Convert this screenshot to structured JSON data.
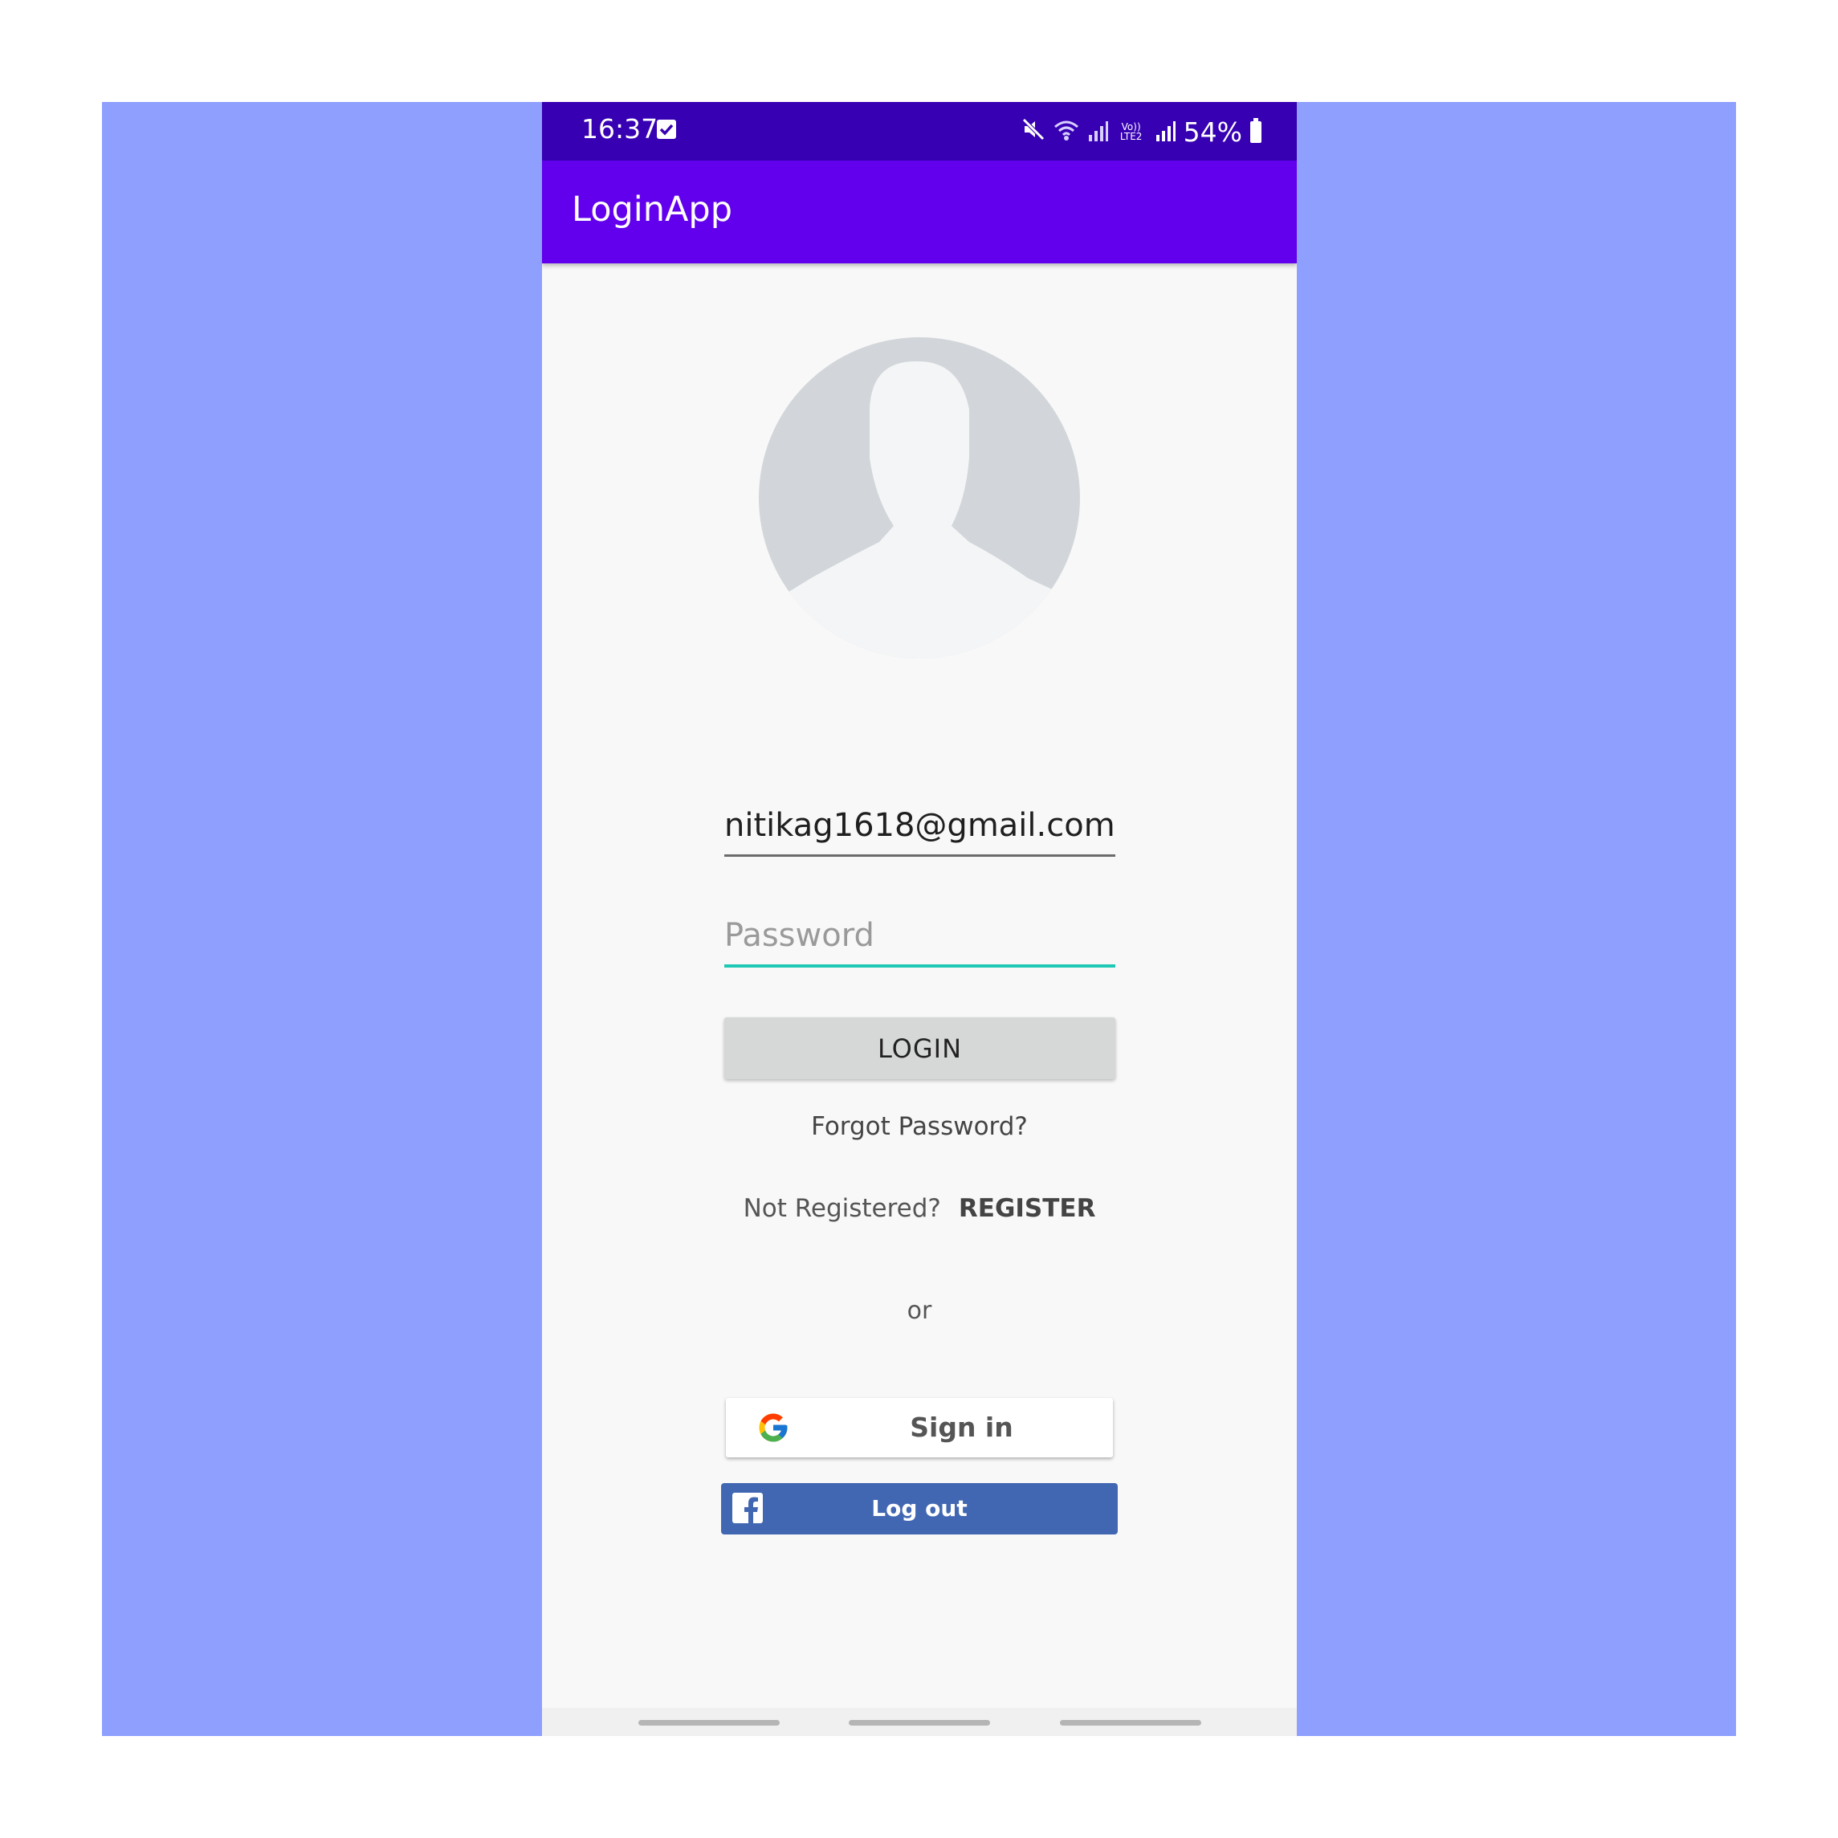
{
  "status_bar": {
    "time": "16:37",
    "volte_label": "Vo)) LTE2",
    "battery": "54%",
    "icons": [
      "checkbox-notification-icon",
      "mute-icon",
      "wifi-icon",
      "signal-icon",
      "signal-icon",
      "battery-icon"
    ]
  },
  "app_bar": {
    "title": "LoginApp"
  },
  "form": {
    "email_value": "nitikag1618@gmail.com",
    "password_placeholder": "Password",
    "login_label": "LOGIN",
    "forgot_label": "Forgot Password?",
    "not_registered_label": "Not Registered?",
    "register_label": "REGISTER",
    "or_label": "or"
  },
  "social": {
    "google_label": "Sign in",
    "facebook_label": "Log out"
  },
  "colors": {
    "backdrop": "#8e9ffe",
    "status_bar": "#3700b3",
    "app_bar": "#6200ee",
    "accent": "#1ec8b4",
    "facebook": "#4267b2"
  }
}
